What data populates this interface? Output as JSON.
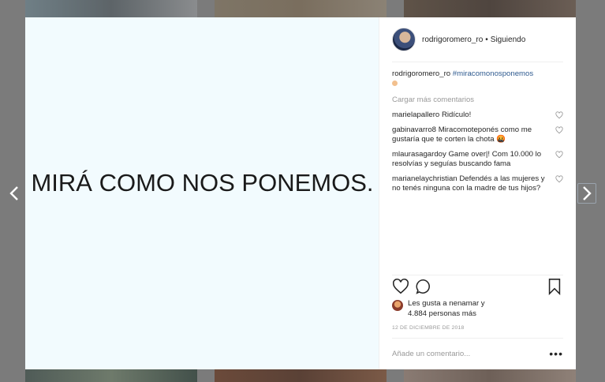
{
  "post": {
    "media_text": "MIRÁ COMO NOS PONEMOS.",
    "author": "rodrigoromero_ro",
    "follow_status": "Siguiendo",
    "caption": {
      "user": "rodrigoromero_ro",
      "hashtag": "#miracomonosponemos"
    },
    "load_more": "Cargar más comentarios",
    "comments": [
      {
        "user": "marielapallero",
        "text": "Ridículo!"
      },
      {
        "user": "gabinavarro8",
        "text": "Miracomoteponés como me gustaría que te corten la chota 🤬"
      },
      {
        "user": "mlaurasagardoy",
        "text": "Game over|! Com 10.000 lo resolvías y seguías buscando fama"
      },
      {
        "user": "marianelaychristian",
        "text": "Defendés a las mujeres y no tenés ninguna con la madre de tus hijos?"
      }
    ],
    "likes_line1": "Les gusta a nenamar y",
    "likes_line2": "4.884 personas más",
    "date": "12 DE DICIEMBRE DE 2018",
    "add_comment_placeholder": "Añade un comentario...",
    "more_options": "•••"
  },
  "icons": {
    "prev": "chevron-left-icon",
    "next": "chevron-right-icon",
    "like": "heart-icon",
    "comment": "comment-bubble-icon",
    "save": "bookmark-icon"
  },
  "colors": {
    "overlay": "#7b7b7b",
    "media_bg": "#f2fbfe",
    "hashtag": "#2e5a8f",
    "muted": "#999999"
  }
}
